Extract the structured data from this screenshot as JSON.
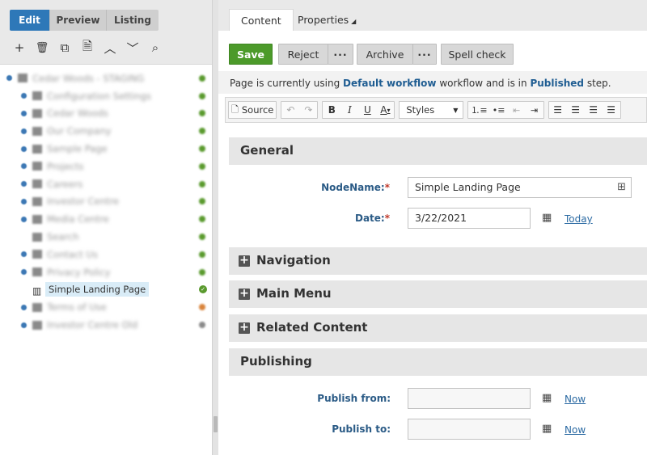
{
  "left": {
    "mode_tabs": [
      "Edit",
      "Preview",
      "Listing"
    ],
    "toolbar_icons": [
      "plus-icon",
      "trash-icon",
      "copy-icon",
      "page-icon",
      "chevron-up-icon",
      "chevron-down-icon",
      "search-icon"
    ],
    "toolbar_glyphs": [
      "+",
      "🗑",
      "⧉",
      "🗎",
      "︿",
      "﹀",
      "⌕"
    ],
    "tree": [
      {
        "label": "Cedar Woods - STAGING",
        "level": 0,
        "blurred": true
      },
      {
        "label": "Configuration Settings",
        "level": 1,
        "blurred": true
      },
      {
        "label": "Cedar Woods",
        "level": 1,
        "blurred": true
      },
      {
        "label": "Our Company",
        "level": 1,
        "blurred": true
      },
      {
        "label": "Sample Page",
        "level": 1,
        "blurred": true
      },
      {
        "label": "Projects",
        "level": 1,
        "blurred": true
      },
      {
        "label": "Careers",
        "level": 1,
        "blurred": true
      },
      {
        "label": "Investor Centre",
        "level": 1,
        "blurred": true
      },
      {
        "label": "Media Centre",
        "level": 1,
        "blurred": true
      },
      {
        "label": "Search",
        "level": 1,
        "blurred": true
      },
      {
        "label": "Contact Us",
        "level": 1,
        "blurred": true
      },
      {
        "label": "Privacy Policy",
        "level": 1,
        "blurred": true
      },
      {
        "label": "Simple Landing Page",
        "level": 1,
        "blurred": false,
        "selected": true
      },
      {
        "label": "Terms of Use",
        "level": 1,
        "blurred": true
      },
      {
        "label": "Investor Centre Old",
        "level": 1,
        "blurred": true
      }
    ],
    "colors": {
      "accent": "#2e78b8",
      "published": "#5a9a2e",
      "warning": "#d9843b"
    }
  },
  "right": {
    "tabs": [
      {
        "label": "Content",
        "active": true
      },
      {
        "label": "Properties",
        "active": false
      }
    ],
    "actions": {
      "save": "Save",
      "reject": "Reject",
      "archive": "Archive",
      "spell": "Spell check",
      "more": "···"
    },
    "workflow": {
      "prefix": "Page is currently using ",
      "workflow": "Default workflow",
      "middle": " workflow and is in ",
      "step": "Published",
      "suffix": " step."
    },
    "editor": {
      "source": "Source",
      "styles": "Styles"
    },
    "sections": {
      "general": "General",
      "navigation": "Navigation",
      "main_menu": "Main Menu",
      "related": "Related Content",
      "publishing": "Publishing"
    },
    "form": {
      "nodename_label": "NodeName:",
      "nodename_value": "Simple Landing Page",
      "date_label": "Date:",
      "date_value": "3/22/2021",
      "today": "Today",
      "publish_from_label": "Publish from:",
      "publish_to_label": "Publish to:",
      "now": "Now",
      "required": "*"
    }
  }
}
